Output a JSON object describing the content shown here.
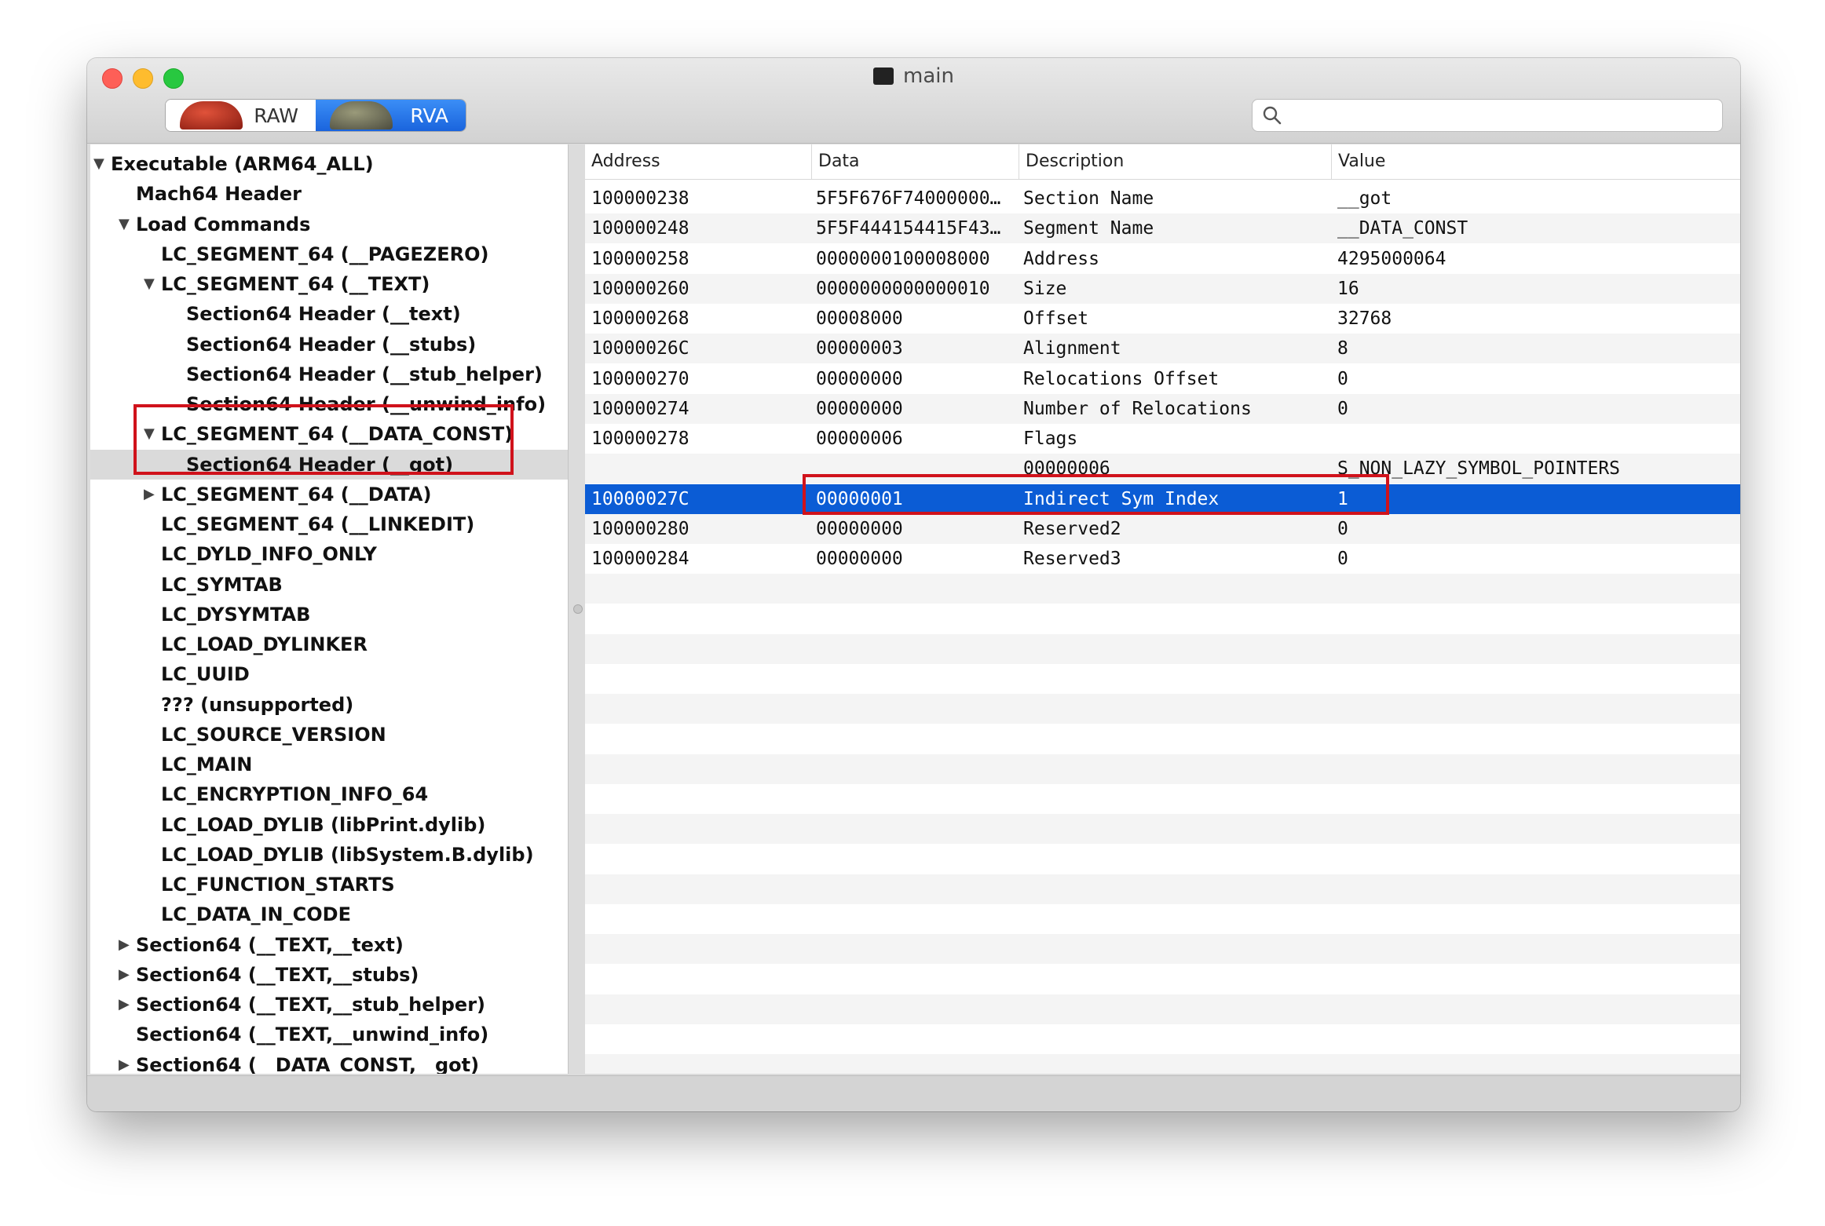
{
  "window": {
    "title": "main"
  },
  "toolbar": {
    "segments": [
      {
        "label": "RAW",
        "selected": false
      },
      {
        "label": "RVA",
        "selected": true
      }
    ],
    "search": {
      "placeholder": "",
      "value": ""
    }
  },
  "sidebar": {
    "items": [
      {
        "label": "Executable  (ARM64_ALL)",
        "level": 0,
        "disclosure": "expanded"
      },
      {
        "label": "Mach64 Header",
        "level": 1,
        "disclosure": "none"
      },
      {
        "label": "Load Commands",
        "level": 1,
        "disclosure": "expanded"
      },
      {
        "label": "LC_SEGMENT_64 (__PAGEZERO)",
        "level": 2,
        "disclosure": "none"
      },
      {
        "label": "LC_SEGMENT_64 (__TEXT)",
        "level": 2,
        "disclosure": "expanded"
      },
      {
        "label": "Section64 Header (__text)",
        "level": 3,
        "disclosure": "none"
      },
      {
        "label": "Section64 Header (__stubs)",
        "level": 3,
        "disclosure": "none"
      },
      {
        "label": "Section64 Header (__stub_helper)",
        "level": 3,
        "disclosure": "none"
      },
      {
        "label": "Section64 Header (__unwind_info)",
        "level": 3,
        "disclosure": "none"
      },
      {
        "label": "LC_SEGMENT_64 (__DATA_CONST)",
        "level": 2,
        "disclosure": "expanded"
      },
      {
        "label": "Section64 Header (__got)",
        "level": 3,
        "disclosure": "none",
        "selected": true
      },
      {
        "label": "LC_SEGMENT_64 (__DATA)",
        "level": 2,
        "disclosure": "collapsed"
      },
      {
        "label": "LC_SEGMENT_64 (__LINKEDIT)",
        "level": 2,
        "disclosure": "none"
      },
      {
        "label": "LC_DYLD_INFO_ONLY",
        "level": 2,
        "disclosure": "none"
      },
      {
        "label": "LC_SYMTAB",
        "level": 2,
        "disclosure": "none"
      },
      {
        "label": "LC_DYSYMTAB",
        "level": 2,
        "disclosure": "none"
      },
      {
        "label": "LC_LOAD_DYLINKER",
        "level": 2,
        "disclosure": "none"
      },
      {
        "label": "LC_UUID",
        "level": 2,
        "disclosure": "none"
      },
      {
        "label": "??? (unsupported)",
        "level": 2,
        "disclosure": "none"
      },
      {
        "label": "LC_SOURCE_VERSION",
        "level": 2,
        "disclosure": "none"
      },
      {
        "label": "LC_MAIN",
        "level": 2,
        "disclosure": "none"
      },
      {
        "label": "LC_ENCRYPTION_INFO_64",
        "level": 2,
        "disclosure": "none"
      },
      {
        "label": "LC_LOAD_DYLIB (libPrint.dylib)",
        "level": 2,
        "disclosure": "none"
      },
      {
        "label": "LC_LOAD_DYLIB (libSystem.B.dylib)",
        "level": 2,
        "disclosure": "none"
      },
      {
        "label": "LC_FUNCTION_STARTS",
        "level": 2,
        "disclosure": "none"
      },
      {
        "label": "LC_DATA_IN_CODE",
        "level": 2,
        "disclosure": "none"
      },
      {
        "label": "Section64 (__TEXT,__text)",
        "level": 1,
        "disclosure": "collapsed"
      },
      {
        "label": "Section64 (__TEXT,__stubs)",
        "level": 1,
        "disclosure": "collapsed"
      },
      {
        "label": "Section64 (__TEXT,__stub_helper)",
        "level": 1,
        "disclosure": "collapsed"
      },
      {
        "label": "Section64 (__TEXT,__unwind_info)",
        "level": 1,
        "disclosure": "none"
      },
      {
        "label": "Section64 (__DATA_CONST,__got)",
        "level": 1,
        "disclosure": "collapsed"
      }
    ]
  },
  "table": {
    "columns": [
      "Address",
      "Data",
      "Description",
      "Value"
    ],
    "rows": [
      {
        "address": "100000238",
        "data": "5F5F676F74000000…",
        "description": "Section Name",
        "value": "__got"
      },
      {
        "address": "100000248",
        "data": "5F5F444154415F43…",
        "description": "Segment Name",
        "value": "__DATA_CONST"
      },
      {
        "address": "100000258",
        "data": "0000000100008000",
        "description": "Address",
        "value": "4295000064"
      },
      {
        "address": "100000260",
        "data": "0000000000000010",
        "description": "Size",
        "value": "16"
      },
      {
        "address": "100000268",
        "data": "00008000",
        "description": "Offset",
        "value": "32768"
      },
      {
        "address": "10000026C",
        "data": "00000003",
        "description": "Alignment",
        "value": "8"
      },
      {
        "address": "100000270",
        "data": "00000000",
        "description": "Relocations Offset",
        "value": "0"
      },
      {
        "address": "100000274",
        "data": "00000000",
        "description": "Number of Relocations",
        "value": "0"
      },
      {
        "address": "100000278",
        "data": "00000006",
        "description": "Flags",
        "value": ""
      },
      {
        "address": "",
        "data": "",
        "description": "00000006",
        "value": "S_NON_LAZY_SYMBOL_POINTERS"
      },
      {
        "address": "10000027C",
        "data": "00000001",
        "description": "Indirect Sym Index",
        "value": "1",
        "selected": true
      },
      {
        "address": "100000280",
        "data": "00000000",
        "description": "Reserved2",
        "value": "0"
      },
      {
        "address": "100000284",
        "data": "00000000",
        "description": "Reserved3",
        "value": "0"
      }
    ]
  },
  "colors": {
    "selection": "#0b5cd5",
    "annotation": "#d0121b"
  }
}
